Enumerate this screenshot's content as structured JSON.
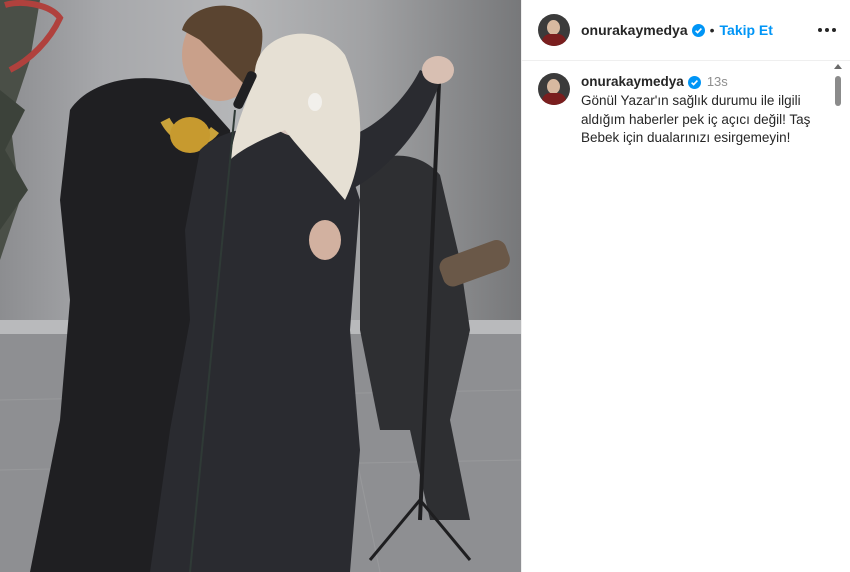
{
  "header": {
    "username": "onurakaymedya",
    "separator": "•",
    "follow_label": "Takip Et",
    "verified": true
  },
  "comment": {
    "username": "onurakaymedya",
    "time": "13s",
    "caption": "Gönül Yazar'ın sağlık durumu ile ilgili aldığım haberler pek iç açıcı değil! Taş Bebek için dualarınızı esirgemeyin!"
  },
  "icons": {
    "verified": "verified-badge-icon",
    "more": "more-options-icon"
  },
  "colors": {
    "accent": "#0095f6",
    "text": "#262626",
    "muted": "#8e8e8e"
  }
}
